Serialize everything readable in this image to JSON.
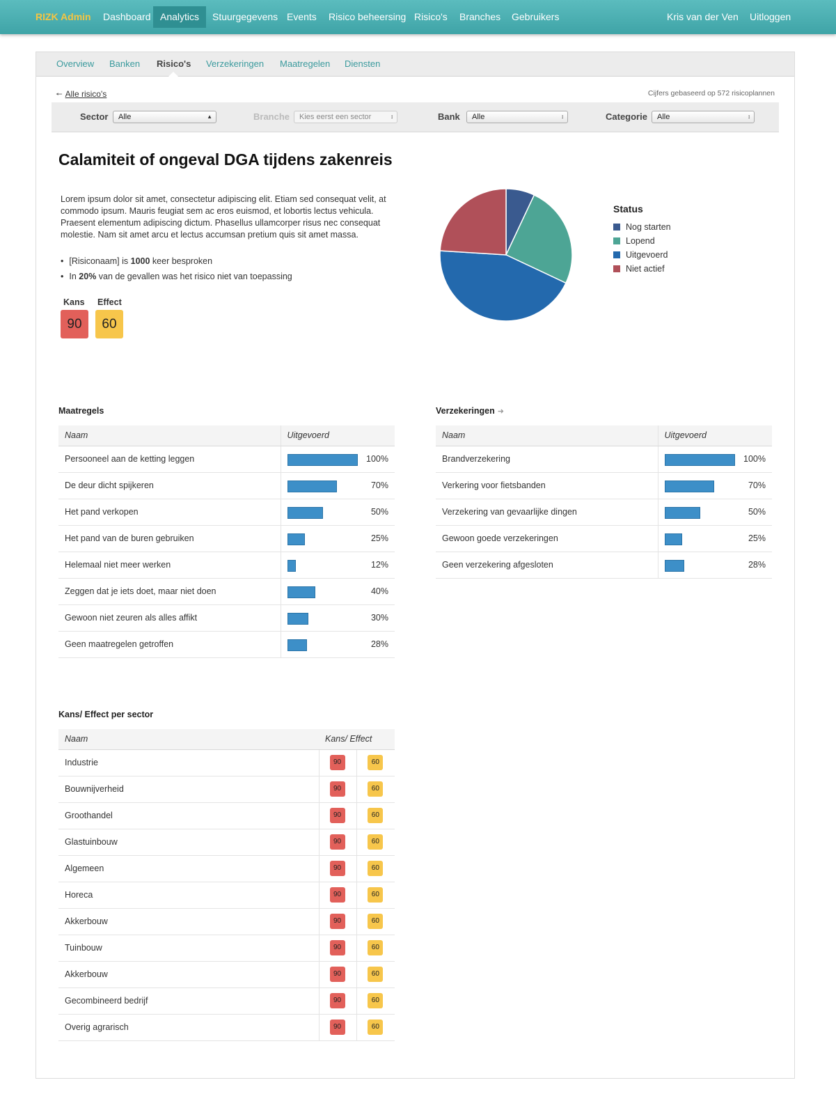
{
  "nav": {
    "brand": "RIZK Admin",
    "items": [
      "Dashboard",
      "Analytics",
      "Stuurgegevens",
      "Events",
      "Risico beheersing",
      "Risico's",
      "Branches",
      "Gebruikers"
    ],
    "user": "Kris van der Ven",
    "logout": "Uitloggen"
  },
  "subnav": {
    "items": [
      "Overview",
      "Banken",
      "Risico's",
      "Verzekeringen",
      "Maatregelen",
      "Diensten"
    ],
    "active": "Risico's"
  },
  "back_link": "Alle risico's",
  "based_on": "Cijfers gebaseerd op 572 risicoplannen",
  "filters": {
    "sector": {
      "label": "Sector",
      "value": "Alle"
    },
    "branche": {
      "label": "Branche",
      "value": "Kies eerst een sector"
    },
    "bank": {
      "label": "Bank",
      "value": "Alle"
    },
    "categorie": {
      "label": "Categorie",
      "value": "Alle"
    }
  },
  "title": "Calamiteit of ongeval DGA tijdens zakenreis",
  "description": "Lorem ipsum dolor sit amet, consectetur adipiscing elit. Etiam sed consequat velit, at commodo ipsum. Mauris feugiat sem ac eros euismod, et lobortis lectus vehicula. Praesent elementum adipiscing dictum. Phasellus ullamcorper risus nec consequat molestie. Nam sit amet arcu et lectus accumsan pretium quis sit amet massa.",
  "bullets": {
    "b1_pre": "[Risiconaam] is ",
    "b1_bold": "1000",
    "b1_post": " keer besproken",
    "b2_pre": "In ",
    "b2_bold": "20%",
    "b2_post": " van de gevallen was het risico niet van toepassing"
  },
  "scores": {
    "kans_label": "Kans",
    "kans": "90",
    "effect_label": "Effect",
    "effect": "60"
  },
  "chart_data": {
    "type": "pie",
    "title": "Status",
    "legend_position": "right",
    "slices": [
      {
        "label": "Nog starten",
        "value": 7,
        "color": "#3a5a8f"
      },
      {
        "label": "Lopend",
        "value": 25,
        "color": "#4da595"
      },
      {
        "label": "Uitgevoerd",
        "value": 44,
        "color": "#2369ad"
      },
      {
        "label": "Niet actief",
        "value": 24,
        "color": "#b05059"
      }
    ]
  },
  "maatregels": {
    "title": "Maatregels",
    "col_name": "Naam",
    "col_value": "Uitgevoerd",
    "rows": [
      {
        "name": "Persooneel aan de ketting leggen",
        "value": 100,
        "label": "100%"
      },
      {
        "name": "De deur dicht spijkeren",
        "value": 70,
        "label": "70%"
      },
      {
        "name": "Het pand verkopen",
        "value": 50,
        "label": "50%"
      },
      {
        "name": "Het pand van de buren gebruiken",
        "value": 25,
        "label": "25%"
      },
      {
        "name": "Helemaal niet meer werken",
        "value": 12,
        "label": "12%"
      },
      {
        "name": "Zeggen dat je iets doet, maar niet doen",
        "value": 40,
        "label": "40%"
      },
      {
        "name": "Gewoon niet zeuren als alles affikt",
        "value": 30,
        "label": "30%"
      },
      {
        "name": "Geen maatregelen getroffen",
        "value": 28,
        "label": "28%"
      }
    ]
  },
  "verzekeringen": {
    "title": "Verzekeringen",
    "col_name": "Naam",
    "col_value": "Uitgevoerd",
    "rows": [
      {
        "name": "Brandverzekering",
        "value": 100,
        "label": "100%"
      },
      {
        "name": "Verkering voor fietsbanden",
        "value": 70,
        "label": "70%"
      },
      {
        "name": "Verzekering van gevaarlijke dingen",
        "value": 50,
        "label": "50%"
      },
      {
        "name": "Gewoon goede verzekeringen",
        "value": 25,
        "label": "25%"
      },
      {
        "name": "Geen verzekering afgesloten",
        "value": 28,
        "label": "28%"
      }
    ]
  },
  "sector_table": {
    "title": "Kans/ Effect per sector",
    "col_name": "Naam",
    "col_value": "Kans/ Effect",
    "rows": [
      {
        "name": "Industrie",
        "kans": "90",
        "effect": "60"
      },
      {
        "name": "Bouwnijverheid",
        "kans": "90",
        "effect": "60"
      },
      {
        "name": "Groothandel",
        "kans": "90",
        "effect": "60"
      },
      {
        "name": "Glastuinbouw",
        "kans": "90",
        "effect": "60"
      },
      {
        "name": "Algemeen",
        "kans": "90",
        "effect": "60"
      },
      {
        "name": "Horeca",
        "kans": "90",
        "effect": "60"
      },
      {
        "name": "Akkerbouw",
        "kans": "90",
        "effect": "60"
      },
      {
        "name": "Tuinbouw",
        "kans": "90",
        "effect": "60"
      },
      {
        "name": "Akkerbouw",
        "kans": "90",
        "effect": "60"
      },
      {
        "name": "Gecombineerd bedrijf",
        "kans": "90",
        "effect": "60"
      },
      {
        "name": "Overig agrarisch",
        "kans": "90",
        "effect": "60"
      }
    ]
  }
}
